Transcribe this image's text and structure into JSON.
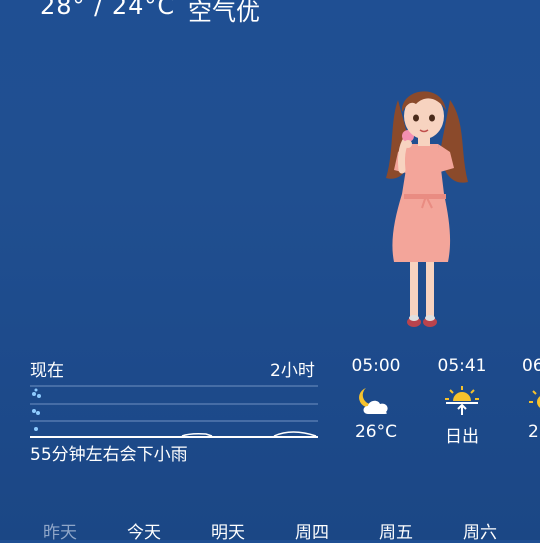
{
  "header": {
    "temperature_range": "28° / 24°C",
    "air_quality": "空气优"
  },
  "precipitation": {
    "now_label": "现在",
    "end_label": "2小时",
    "summary": "55分钟左右会下小雨"
  },
  "hourly": [
    {
      "time": "05:00",
      "icon": "partly-cloudy-night-icon",
      "value": "26°C"
    },
    {
      "time": "05:41",
      "icon": "sunrise-icon",
      "value": "日出"
    },
    {
      "time": "06",
      "icon": "sun-icon",
      "value": "2"
    }
  ],
  "tabs": [
    {
      "label": "昨天",
      "state": "dim"
    },
    {
      "label": "今天",
      "state": "normal"
    },
    {
      "label": "明天",
      "state": "normal"
    },
    {
      "label": "周四",
      "state": "normal"
    },
    {
      "label": "周五",
      "state": "normal"
    },
    {
      "label": "周六",
      "state": "normal"
    }
  ],
  "colors": {
    "background": "#1f4f93",
    "rain_drop": "#8ecbff",
    "moon": "#f6c22c",
    "sun": "#f6c22c"
  }
}
